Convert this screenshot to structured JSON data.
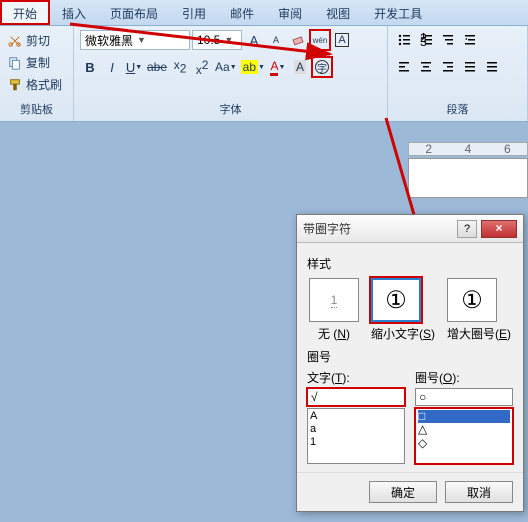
{
  "tabs": {
    "start": "开始",
    "insert": "插入",
    "layout": "页面布局",
    "reference": "引用",
    "mail": "邮件",
    "review": "审阅",
    "view": "视图",
    "developer": "开发工具"
  },
  "clipboard": {
    "cut": "剪切",
    "copy": "复制",
    "brush": "格式刷",
    "label": "剪贴板"
  },
  "font": {
    "name": "微软雅黑",
    "size": "10.5",
    "wen": "wén",
    "aa": "Aa",
    "label": "字体"
  },
  "paragraph": {
    "label": "段落"
  },
  "ruler": {
    "m1": "2",
    "m2": "4",
    "m3": "6"
  },
  "dialog": {
    "title": "带圈字符",
    "style_label": "样式",
    "none": {
      "glyph": "1",
      "label": "无 (",
      "key": "N",
      "close": ")"
    },
    "shrink": {
      "glyph": "①",
      "label": "缩小文字(",
      "key": "S",
      "close": ")"
    },
    "enlarge": {
      "glyph": "①",
      "label": "增大圈号(",
      "key": "E",
      "close": ")"
    },
    "ring_label": "圈号",
    "text_label": "文字(",
    "text_key": "T",
    "text_close": "):",
    "ring_lab2": "圈号(",
    "ring_key": "O",
    "ring_close": "):",
    "text_value": "√",
    "ring_value": "○",
    "text_list": "A\na\n1",
    "ring_sel": "□",
    "ring_rest": "△\n◇",
    "ok": "确定",
    "cancel": "取消",
    "help": "?",
    "close": "×"
  }
}
